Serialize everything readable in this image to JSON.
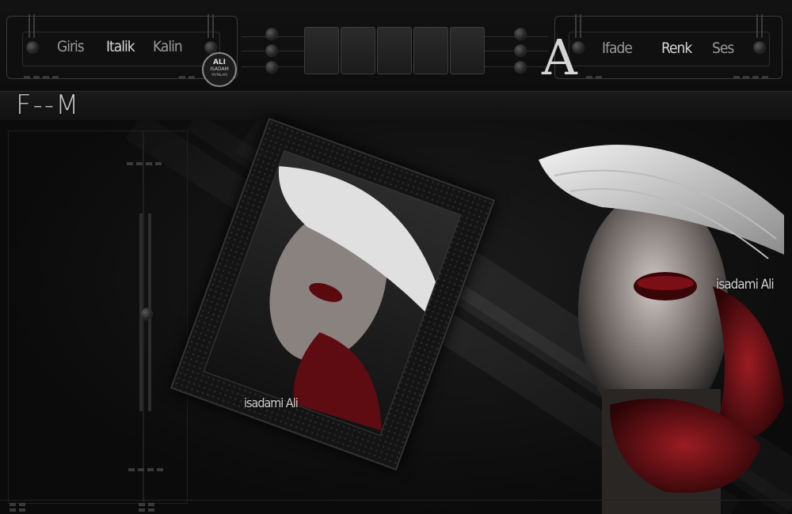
{
  "toolbar_left": {
    "items": [
      {
        "label": "Giris"
      },
      {
        "label": "Italik"
      },
      {
        "label": "Kalin"
      }
    ]
  },
  "badge": {
    "line1": "ALI",
    "line2": "ISADAM",
    "line3": "YAYINLARI"
  },
  "toolbar_right": {
    "glyph": "A",
    "items": [
      {
        "label": "Ifade"
      },
      {
        "label": "Renk"
      },
      {
        "label": "Ses"
      }
    ]
  },
  "header": {
    "logo": "F--M"
  },
  "signatures": {
    "main": "isadami Ali",
    "frame": "isadami Ali"
  },
  "colors": {
    "background": "#0b0b0b",
    "accent_red": "#6e0f14",
    "hat_white": "#e8e8e8"
  }
}
